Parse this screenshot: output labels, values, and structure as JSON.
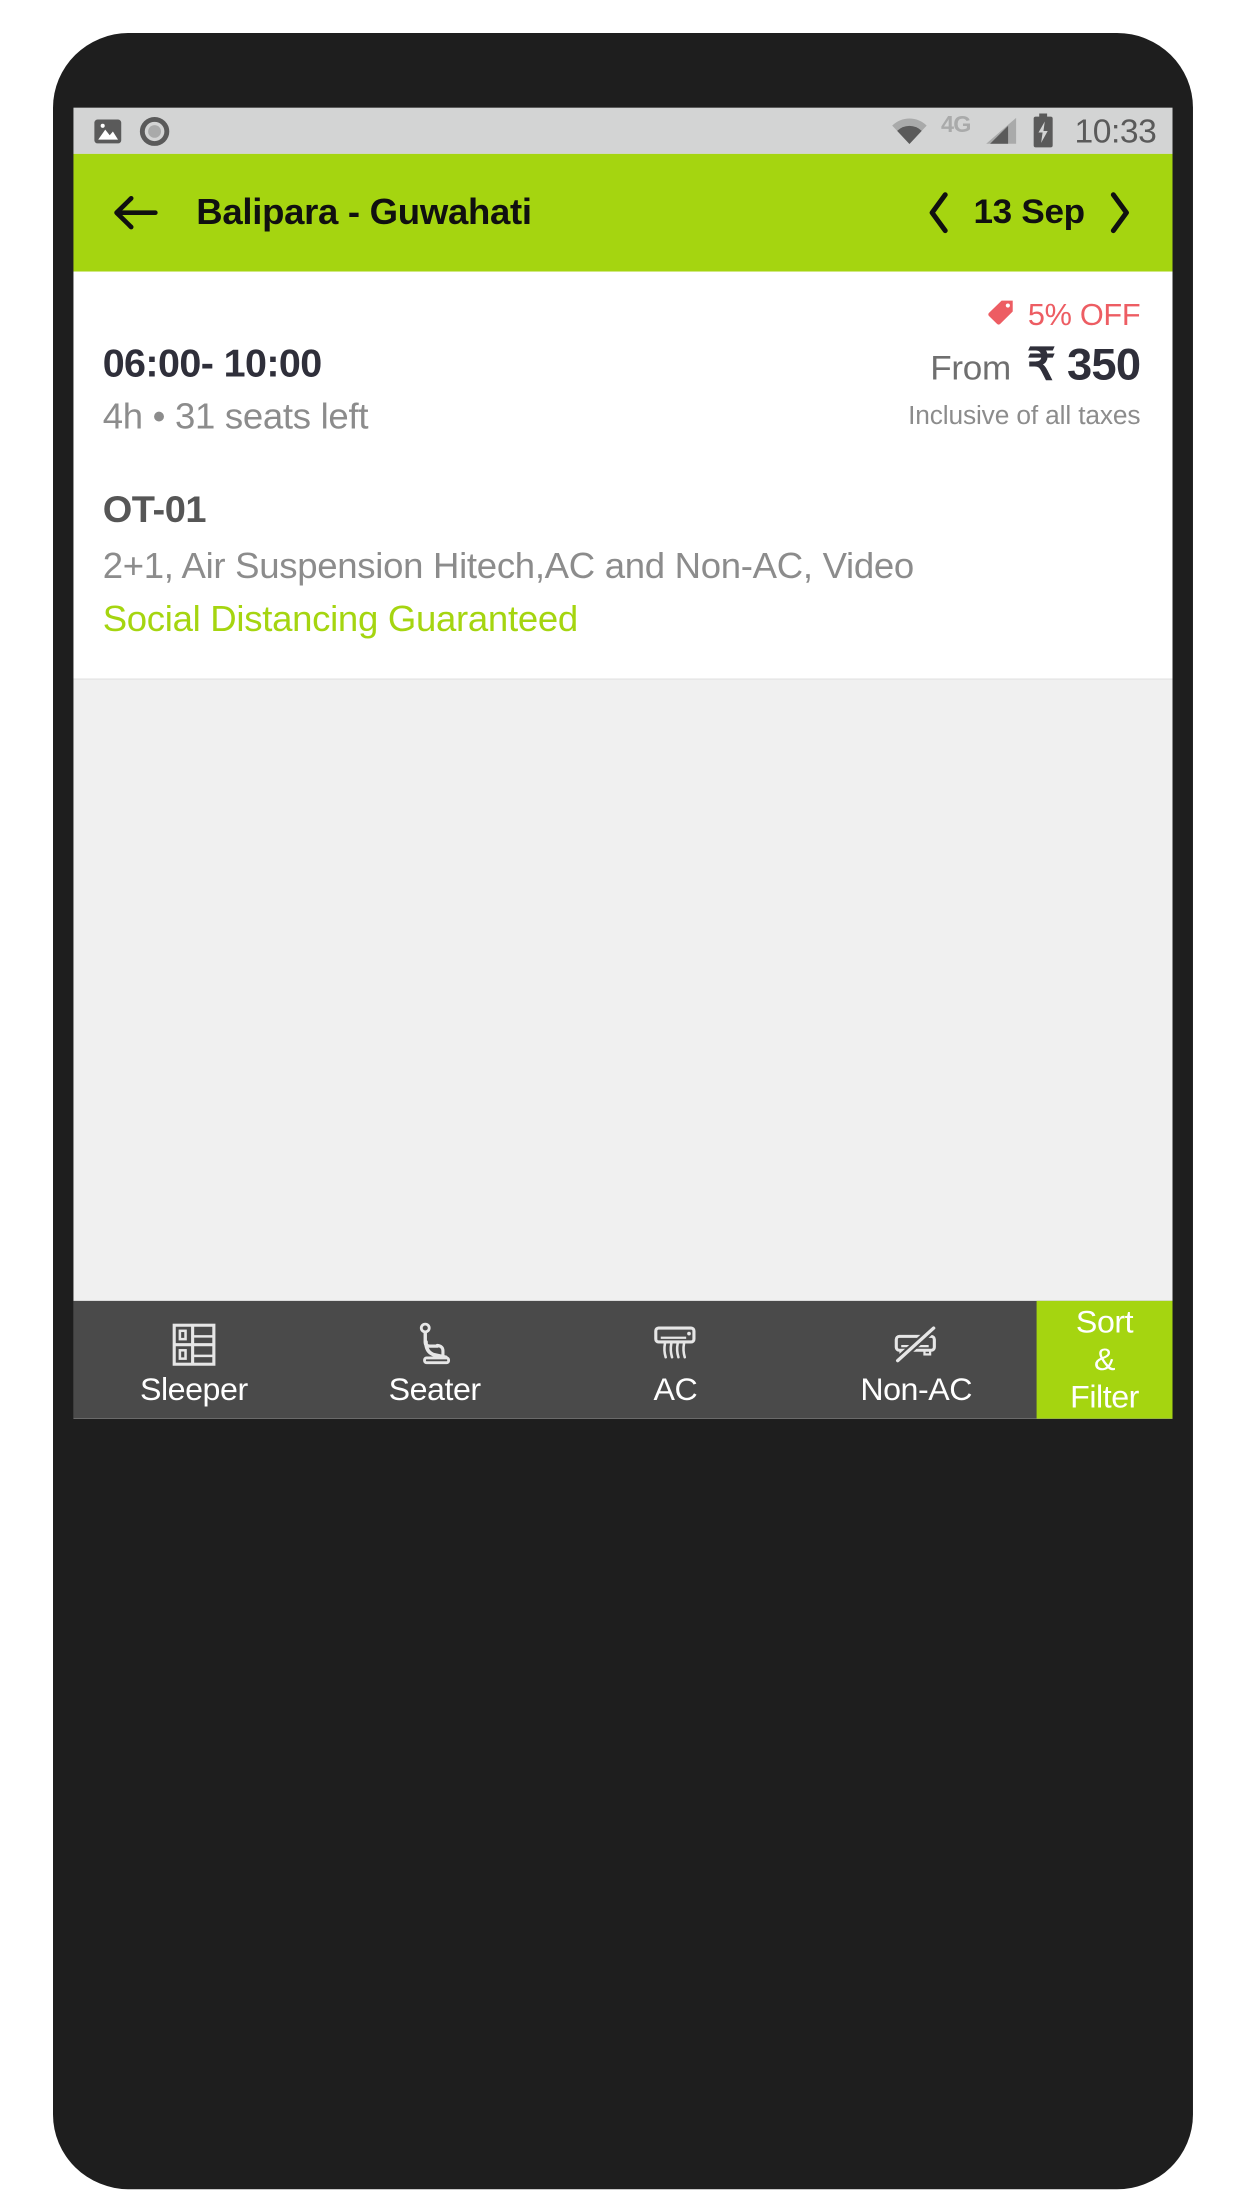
{
  "status_bar": {
    "time": "10:33",
    "network_label": "4G",
    "icons": [
      "image-icon",
      "record-icon",
      "wifi-icon",
      "signal-icon",
      "battery-charging-icon"
    ]
  },
  "app_bar": {
    "back_label": "back-arrow",
    "route_title": "Balipara - Guwahati",
    "date_label": "13 Sep",
    "prev_day_label": "prev-day",
    "next_day_label": "next-day",
    "background_color": "#A5D510"
  },
  "bus_card": {
    "discount": "5% OFF",
    "discount_color": "#ED5D63",
    "trip_time": "06:00- 10:00",
    "trip_meta": "4h • 31 seats left",
    "fare_prefix": "From",
    "fare_amount": "₹ 350",
    "fare_note": "Inclusive of all taxes",
    "operator_name": "OT-01",
    "operator_description": "2+1, Air Suspension Hitech,AC and Non-AC, Video",
    "distancing_note": "Social Distancing Guaranteed",
    "distancing_color": "#A5D510"
  },
  "filter_bar": {
    "background_color": "#4A4A4A",
    "items": [
      {
        "label": "Sleeper",
        "icon": "sleeper-berth-icon"
      },
      {
        "label": "Seater",
        "icon": "seat-icon"
      },
      {
        "label": "AC",
        "icon": "air-conditioner-icon"
      },
      {
        "label": "Non-AC",
        "icon": "air-conditioner-slashed-icon"
      }
    ],
    "sort_filter": {
      "line1": "Sort",
      "line2": "&",
      "line3": "Filter",
      "background_color": "#A5D510"
    }
  }
}
